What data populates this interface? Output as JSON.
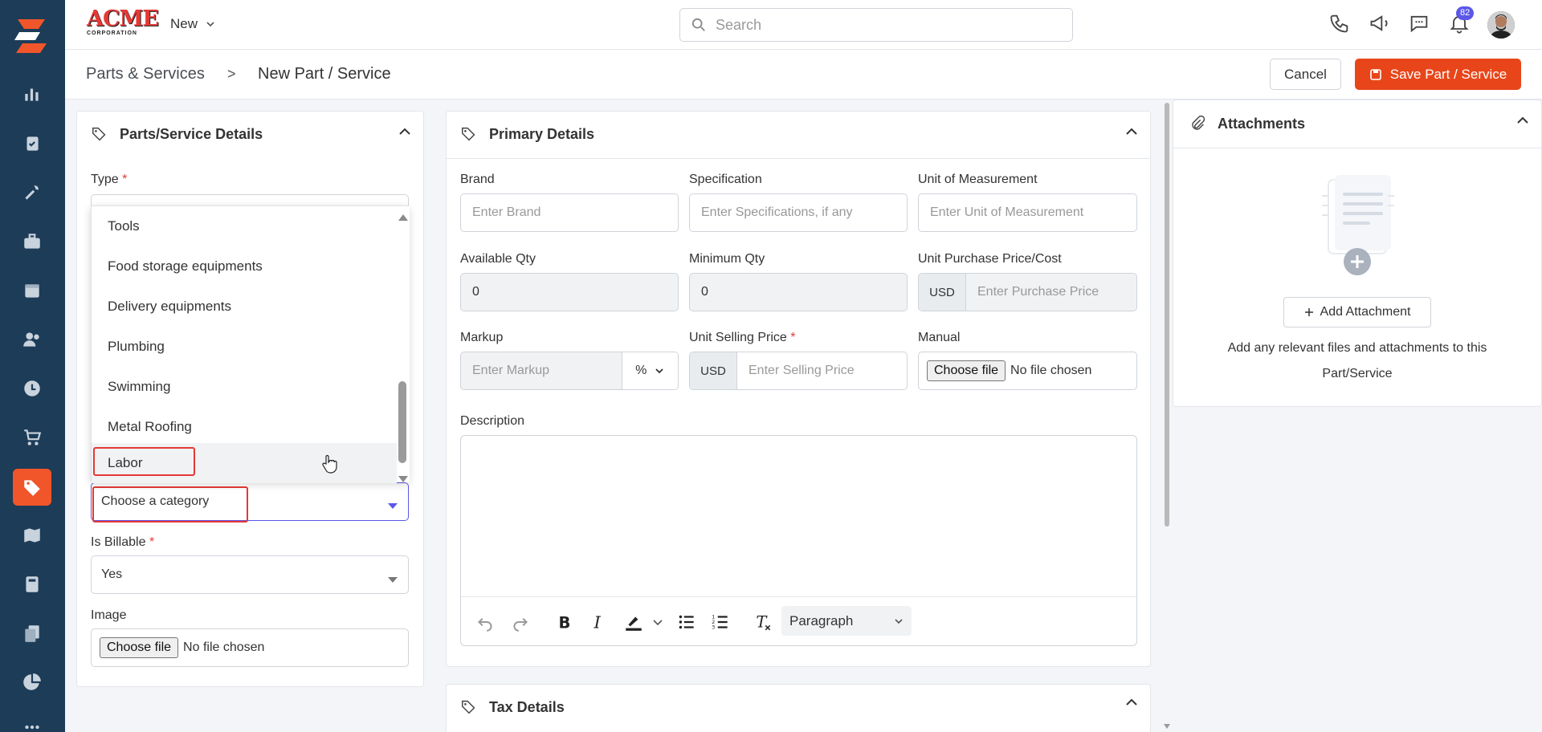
{
  "app": {
    "brand_top": "ACME",
    "brand_bottom": "CORPORATION",
    "new_menu": "New"
  },
  "search": {
    "placeholder": "Search"
  },
  "notifications": {
    "count": "82"
  },
  "breadcrumb": {
    "parent": "Parts & Services",
    "separator": ">",
    "current": "New Part / Service"
  },
  "actions": {
    "cancel": "Cancel",
    "save": "Save Part / Service"
  },
  "left_card": {
    "title": "Parts/Service Details",
    "type_label": "Type",
    "category_placeholder": "Choose a category",
    "billable_label": "Is Billable",
    "billable_value": "Yes",
    "image_label": "Image",
    "file_button": "Choose file",
    "file_status": "No file chosen",
    "dropdown_items": [
      "Tools",
      "Food storage equipments",
      "Delivery equipments",
      "Plumbing",
      "Swimming",
      "Metal Roofing",
      "Labor"
    ]
  },
  "primary": {
    "title": "Primary Details",
    "brand_label": "Brand",
    "brand_placeholder": "Enter Brand",
    "spec_label": "Specification",
    "spec_placeholder": "Enter Specifications, if any",
    "uom_label": "Unit of Measurement",
    "uom_placeholder": "Enter Unit of Measurement",
    "avail_label": "Available Qty",
    "avail_value": "0",
    "min_label": "Minimum Qty",
    "min_value": "0",
    "purchase_label": "Unit Purchase Price/Cost",
    "currency": "USD",
    "purchase_placeholder": "Enter Purchase Price",
    "markup_label": "Markup",
    "markup_placeholder": "Enter Markup",
    "markup_unit": "%",
    "selling_label": "Unit Selling Price",
    "selling_placeholder": "Enter Selling Price",
    "manual_label": "Manual",
    "file_button": "Choose file",
    "file_status": "No file chosen",
    "description_label": "Description",
    "paragraph_select": "Paragraph"
  },
  "tax": {
    "title": "Tax Details"
  },
  "attachments": {
    "title": "Attachments",
    "add_button": "Add Attachment",
    "help_line1": "Add any relevant files and attachments to this",
    "help_line2": "Part/Service"
  },
  "colors": {
    "accent": "#e8461a",
    "sidebar": "#1d3c58",
    "highlight": "#e53935",
    "badge": "#5b57e8"
  }
}
